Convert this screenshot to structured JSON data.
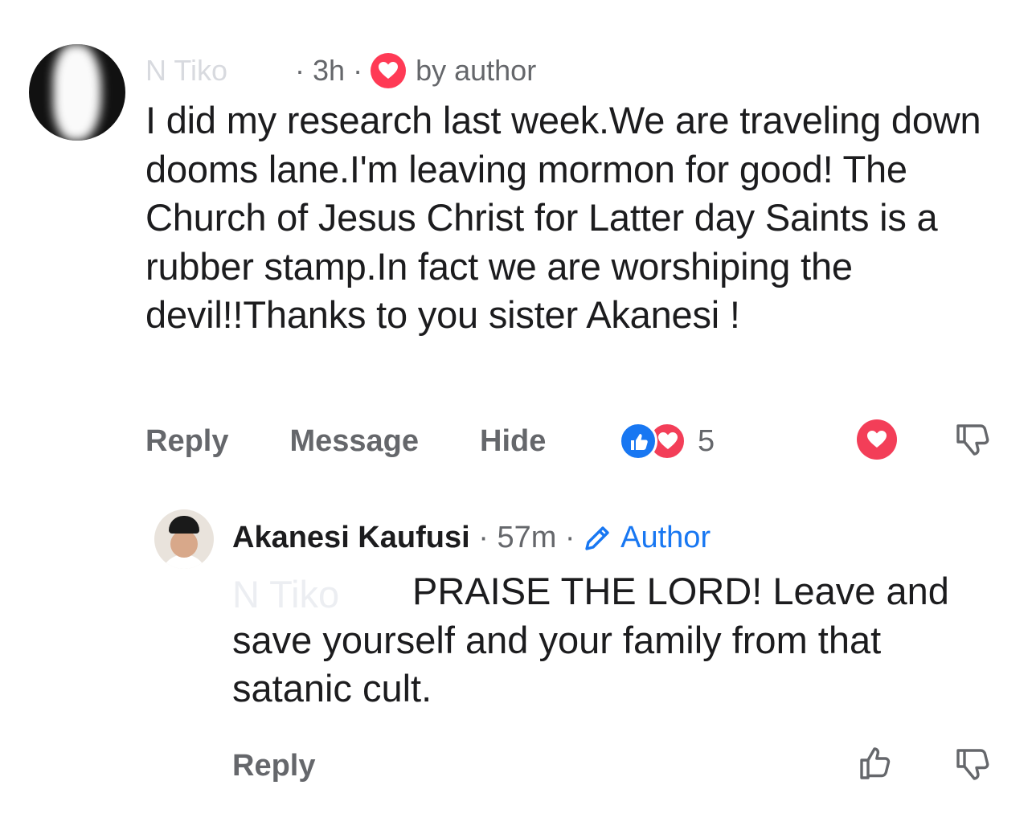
{
  "comment": {
    "author_redacted": "N     Tiko",
    "time": "3h",
    "badge_label": "by author",
    "text": "I did my research last week.We are traveling down dooms lane.I'm leaving mormon for good! The Church of Jesus Christ for Latter day Saints is a rubber stamp.In fact we are worshiping the devil!!Thanks to you sister Akanesi !",
    "actions": {
      "reply": "Reply",
      "message": "Message",
      "hide": "Hide"
    },
    "reaction_count": "5",
    "reaction_icons": [
      "like-icon",
      "love-icon"
    ],
    "colors": {
      "love": "#f33e58",
      "like": "#1877f2",
      "meta": "#65676b"
    }
  },
  "reply": {
    "author": "Akanesi Kaufusi",
    "time": "57m",
    "role_label": "Author",
    "mention_redacted": "N     Tiko",
    "text": "PRAISE THE LORD! Leave and save yourself and your family from that satanic cult.",
    "actions": {
      "reply": "Reply"
    },
    "colors": {
      "author": "#1877f2"
    }
  },
  "separator": "·"
}
